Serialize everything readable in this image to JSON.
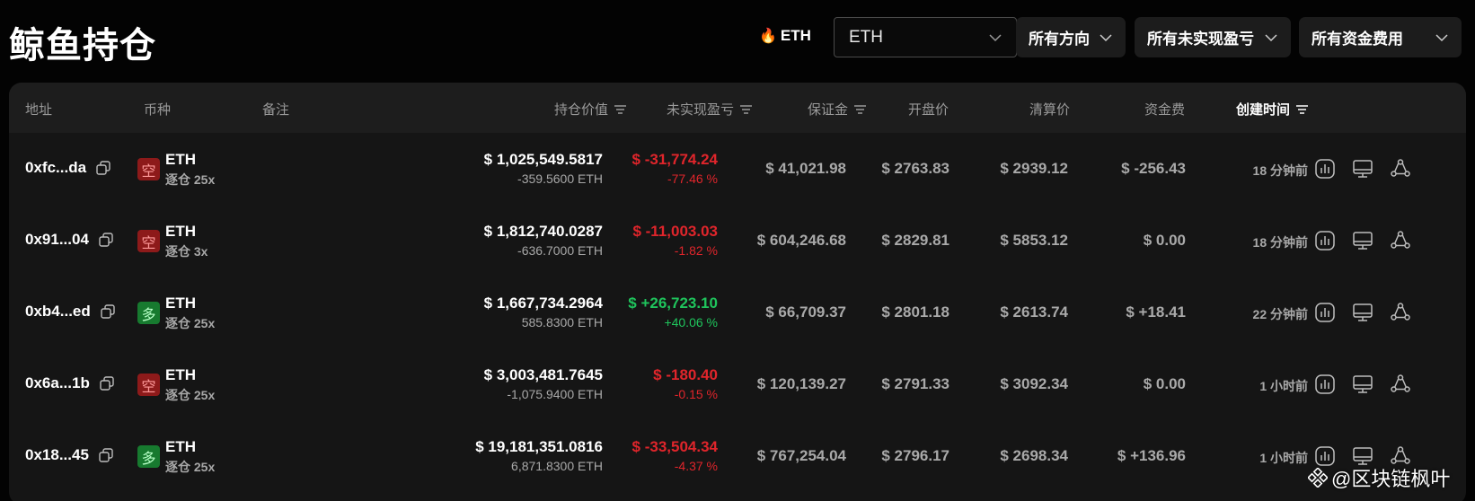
{
  "page": {
    "title": "鲸鱼持仓"
  },
  "filters": {
    "hot_coin": "ETH",
    "coin_select": "ETH",
    "direction": "所有方向",
    "pnl": "所有未实现盈亏",
    "funding": "所有资金费用"
  },
  "table": {
    "headers": {
      "address": "地址",
      "coin": "币种",
      "note": "备注",
      "position_value": "持仓价值",
      "unrealized_pnl": "未实现盈亏",
      "margin": "保证金",
      "entry_price": "开盘价",
      "liq_price": "清算价",
      "funding_fee": "资金费",
      "created_time": "创建时间"
    },
    "rows": [
      {
        "address": "0xfc...da",
        "side": "空",
        "side_type": "short",
        "coin": "ETH",
        "leverage": "逐仓 25x",
        "value": "$ 1,025,549.5817",
        "size": "-359.5600 ETH",
        "pnl": "$ -31,774.24",
        "pnl_pct": "-77.46 %",
        "pnl_sign": "neg",
        "margin": "$ 41,021.98",
        "entry": "$ 2763.83",
        "liq": "$ 2939.12",
        "funding": "$ -256.43",
        "funding_sign": "neg",
        "time": "18 分钟前"
      },
      {
        "address": "0x91...04",
        "side": "空",
        "side_type": "short",
        "coin": "ETH",
        "leverage": "逐仓 3x",
        "value": "$ 1,812,740.0287",
        "size": "-636.7000 ETH",
        "pnl": "$ -11,003.03",
        "pnl_pct": "-1.82 %",
        "pnl_sign": "neg",
        "margin": "$ 604,246.68",
        "entry": "$ 2829.81",
        "liq": "$ 5853.12",
        "funding": "$ 0.00",
        "funding_sign": "plain",
        "time": "18 分钟前"
      },
      {
        "address": "0xb4...ed",
        "side": "多",
        "side_type": "long",
        "coin": "ETH",
        "leverage": "逐仓 25x",
        "value": "$ 1,667,734.2964",
        "size": "585.8300 ETH",
        "pnl": "$ +26,723.10",
        "pnl_pct": "+40.06 %",
        "pnl_sign": "pos",
        "margin": "$ 66,709.37",
        "entry": "$ 2801.18",
        "liq": "$ 2613.74",
        "funding": "$ +18.41",
        "funding_sign": "pos",
        "time": "22 分钟前"
      },
      {
        "address": "0x6a...1b",
        "side": "空",
        "side_type": "short",
        "coin": "ETH",
        "leverage": "逐仓 25x",
        "value": "$ 3,003,481.7645",
        "size": "-1,075.9400 ETH",
        "pnl": "$ -180.40",
        "pnl_pct": "-0.15 %",
        "pnl_sign": "neg",
        "margin": "$ 120,139.27",
        "entry": "$ 2791.33",
        "liq": "$ 3092.34",
        "funding": "$ 0.00",
        "funding_sign": "plain",
        "time": "1 小时前"
      },
      {
        "address": "0x18...45",
        "side": "多",
        "side_type": "long",
        "coin": "ETH",
        "leverage": "逐仓 25x",
        "value": "$ 19,181,351.0816",
        "size": "6,871.8300 ETH",
        "pnl": "$ -33,504.34",
        "pnl_pct": "-4.37 %",
        "pnl_sign": "neg",
        "margin": "$ 767,254.04",
        "entry": "$ 2796.17",
        "liq": "$ 2698.34",
        "funding": "$ +136.96",
        "funding_sign": "pos",
        "time": "1 小时前"
      }
    ]
  },
  "watermark": "@区块链枫叶",
  "icons": {
    "copy": "copy-icon",
    "chart": "chart-icon",
    "monitor": "monitor-icon",
    "share": "share-icon",
    "sort": "sort-icon",
    "chevron": "chevron-down-icon",
    "fire": "fire-icon"
  },
  "colors": {
    "negative": "#e0252b",
    "positive": "#1fc45c",
    "short_badge": "#8d1a1a",
    "long_badge": "#177a2f"
  }
}
